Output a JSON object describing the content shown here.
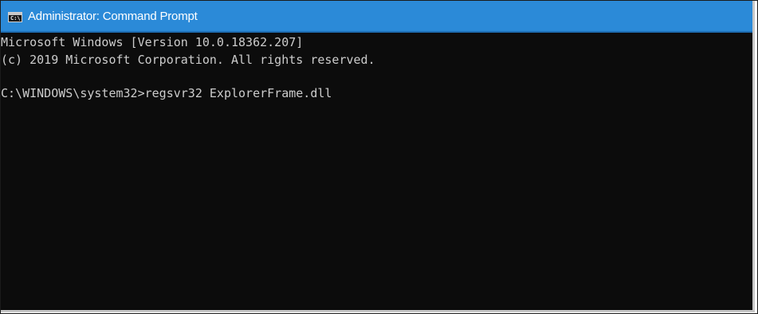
{
  "window": {
    "title": "Administrator: Command Prompt",
    "icon": "command-prompt-icon",
    "icon_glyph": "C:\\"
  },
  "console": {
    "lines": [
      "Microsoft Windows [Version 10.0.18362.207]",
      "(c) 2019 Microsoft Corporation. All rights reserved.",
      "C:\\WINDOWS\\system32>regsvr32 ExplorerFrame.dll"
    ]
  },
  "colors": {
    "titlebar": "#2b8ad8",
    "console_background": "#0c0c0c",
    "console_text": "#cccccc"
  }
}
